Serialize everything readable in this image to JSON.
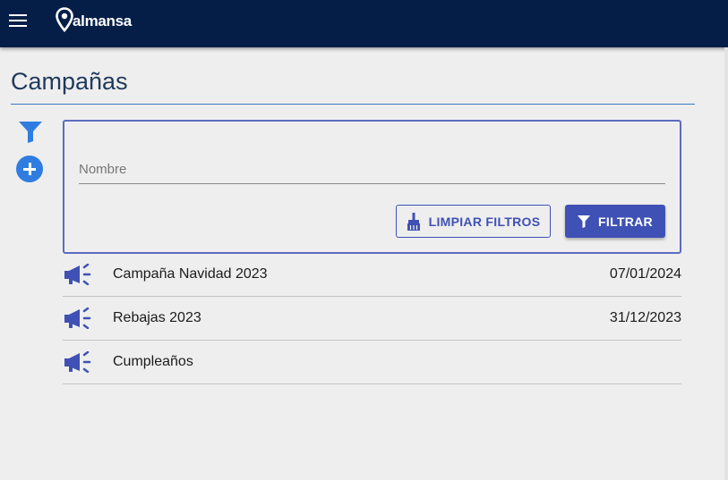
{
  "header": {
    "brand": "almansa",
    "menu_icon": "hamburger-menu-icon",
    "logo_icon": "location-pin-logo"
  },
  "page": {
    "title": "Campañas"
  },
  "sidebar_actions": {
    "filter_icon": "funnel-icon",
    "add_icon": "plus-circle-icon"
  },
  "filters": {
    "name_placeholder": "Nombre",
    "name_value": "",
    "clear_label": "LIMPIAR FILTROS",
    "filter_label": "FILTRAR"
  },
  "campaigns": [
    {
      "name": "Campaña Navidad 2023",
      "date": "07/01/2024",
      "icon": "megaphone-icon"
    },
    {
      "name": "Rebajas 2023",
      "date": "31/12/2023",
      "icon": "megaphone-icon"
    },
    {
      "name": "Cumpleaños",
      "date": "",
      "icon": "megaphone-icon"
    }
  ],
  "colors": {
    "topbar": "#051e47",
    "accent": "#3f51b5",
    "add_button": "#2f7de1",
    "title_rule": "#3b78c3"
  }
}
